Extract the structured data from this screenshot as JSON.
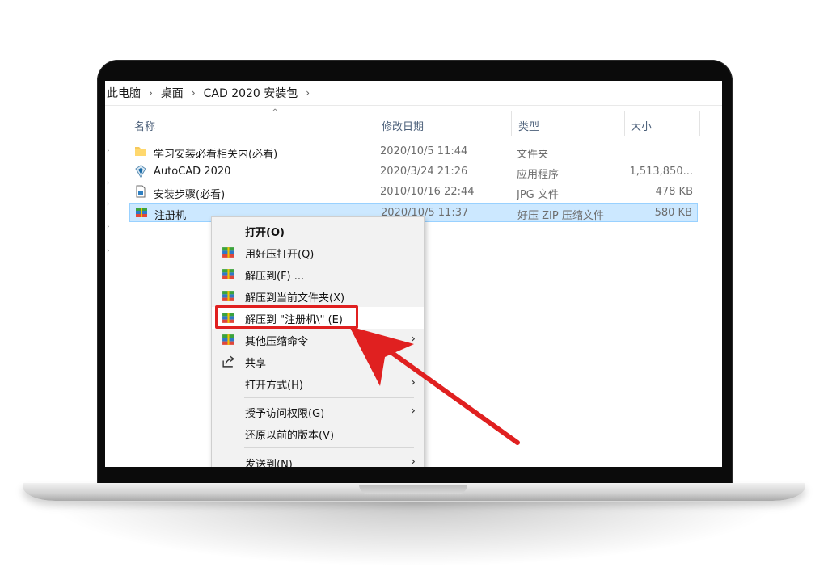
{
  "breadcrumb": [
    "此电脑",
    "桌面",
    "CAD 2020 安装包"
  ],
  "columns": {
    "name": "名称",
    "date": "修改日期",
    "type": "类型",
    "size": "大小"
  },
  "files": [
    {
      "name": "学习安装必看相关内(必看)",
      "date": "2020/10/5 11:44",
      "type": "文件夹",
      "size": "",
      "icon": "folder-icon"
    },
    {
      "name": "AutoCAD 2020",
      "date": "2020/3/24 21:26",
      "type": "应用程序",
      "size": "1,513,850...",
      "icon": "autocad-app-icon"
    },
    {
      "name": "安装步骤(必看)",
      "date": "2010/10/16 22:44",
      "type": "JPG 文件",
      "size": "478 KB",
      "icon": "image-file-icon"
    },
    {
      "name": "注册机",
      "date": "2020/10/5 11:37",
      "type": "好压 ZIP 压缩文件",
      "size": "580 KB",
      "icon": "zip-archive-icon"
    }
  ],
  "context_menu": {
    "open": "打开(O)",
    "open_with_haozip": "用好压打开(Q)",
    "extract_to": "解压到(F) ...",
    "extract_here": "解压到当前文件夹(X)",
    "extract_to_folder": "解压到 \"注册机\\\" (E)",
    "other_compress": "其他压缩命令",
    "share": "共享",
    "open_with": "打开方式(H)",
    "grant_access": "授予访问权限(G)",
    "restore_versions": "还原以前的版本(V)",
    "send_to": "发送到(N)"
  },
  "colors": {
    "selection": "#cce8ff",
    "annotation": "#e02020"
  }
}
